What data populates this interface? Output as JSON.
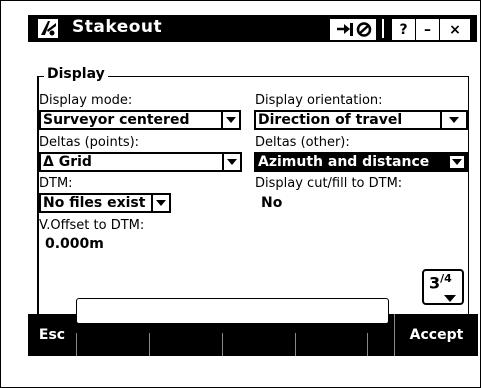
{
  "window": {
    "title": "Stakeout",
    "icon": "stakeout-app-icon",
    "buttons": {
      "switch": "switch-app-icon",
      "favorites": "favorites-icon",
      "help": "?",
      "minimize": "–",
      "close": "×"
    }
  },
  "group": {
    "legend": "Display"
  },
  "fields": {
    "display_mode": {
      "label": "Display mode:",
      "value": "Surveyor centered"
    },
    "display_orientation": {
      "label": "Display orientation:",
      "value": "Direction of travel"
    },
    "deltas_points": {
      "label": "Deltas (points):",
      "value": "Δ Grid"
    },
    "deltas_other": {
      "label": "Deltas (other):",
      "value": "Azimuth and distance"
    },
    "dtm": {
      "label": "DTM:",
      "value": "No files exist"
    },
    "cutfill": {
      "label": "Display cut/fill to DTM:",
      "value": "No"
    },
    "voffset": {
      "label": "V.Offset to DTM:",
      "value": "0.000m"
    }
  },
  "page": {
    "current": "3",
    "total": "4"
  },
  "bottom": {
    "esc": "Esc",
    "accept": "Accept"
  },
  "colors": {
    "bar": "#000000",
    "background": "#ffffff"
  }
}
